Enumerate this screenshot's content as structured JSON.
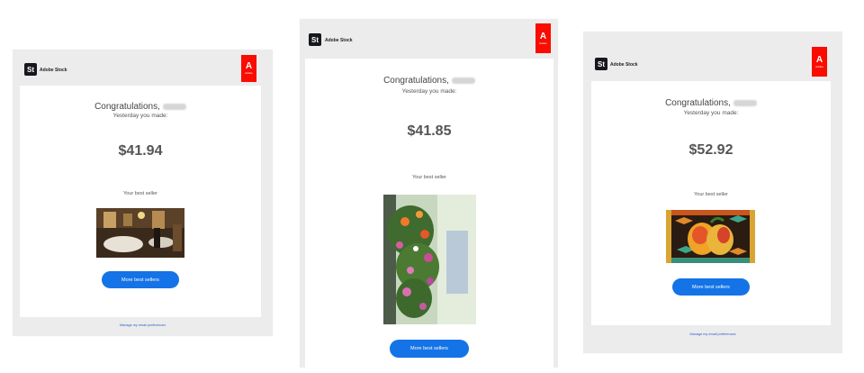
{
  "brand": {
    "name": "Adobe Stock",
    "logo_text": "St",
    "adobe_word": "Adobe"
  },
  "colors": {
    "adobe_red": "#fa0c00",
    "button_blue": "#1473e6",
    "panel_gray": "#ececec"
  },
  "emails": [
    {
      "greeting": "Congratulations,",
      "subtitle": "Yesterday you made:",
      "amount": "$41.94",
      "best_seller_label": "Your best seller",
      "image_subject": "restaurant interior photo",
      "button_label": "More best sellers",
      "footer_link": "Manage my email preferences"
    },
    {
      "greeting": "Congratulations,",
      "subtitle": "Yesterday you made:",
      "amount": "$41.85",
      "best_seller_label": "Your best seller",
      "image_subject": "hanging flower basket photo",
      "button_label": "More best sellers"
    },
    {
      "greeting": "Congratulations,",
      "subtitle": "Yesterday you made:",
      "amount": "$52.92",
      "best_seller_label": "Your best seller",
      "image_subject": "mango illustration",
      "button_label": "More best sellers",
      "footer_link": "Manage my email preferences"
    }
  ]
}
